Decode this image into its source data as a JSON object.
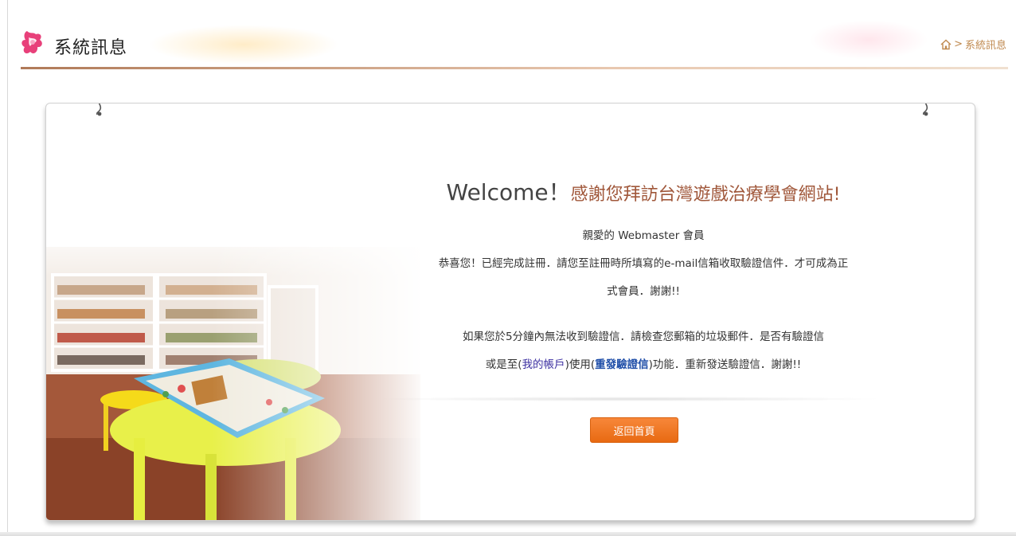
{
  "header": {
    "title": "系統訊息",
    "breadcrumb_current": "系統訊息",
    "breadcrumb_separator": ">"
  },
  "message": {
    "welcome_en": "Welcome！",
    "welcome_zh": "感謝您拜訪台灣遊戲治療學會網站!",
    "greeting": "親愛的 Webmaster 會員",
    "line1": "恭喜您！已經完成註冊．請您至註冊時所填寫的e-mail信箱收取驗證信件．才可成為正",
    "line2": "式會員．謝謝!!",
    "line3": "如果您於5分鐘內無法收到驗證信．請檢查您郵箱的垃圾郵件．是否有驗證信",
    "line4_prefix": "或是至(",
    "my_account_link": "我的帳戶",
    "line4_middle": ")使用(",
    "resend_link": "重發驗證信",
    "line4_suffix": ")功能．重新發送驗證信．謝謝!!"
  },
  "buttons": {
    "back_home": "返回首頁"
  },
  "colors": {
    "accent_orange": "#f07a24",
    "title_brown": "#a0573a",
    "breadcrumb": "#c08a50"
  },
  "icons": {
    "logo": "pink-flower-logo",
    "home": "home-icon"
  }
}
